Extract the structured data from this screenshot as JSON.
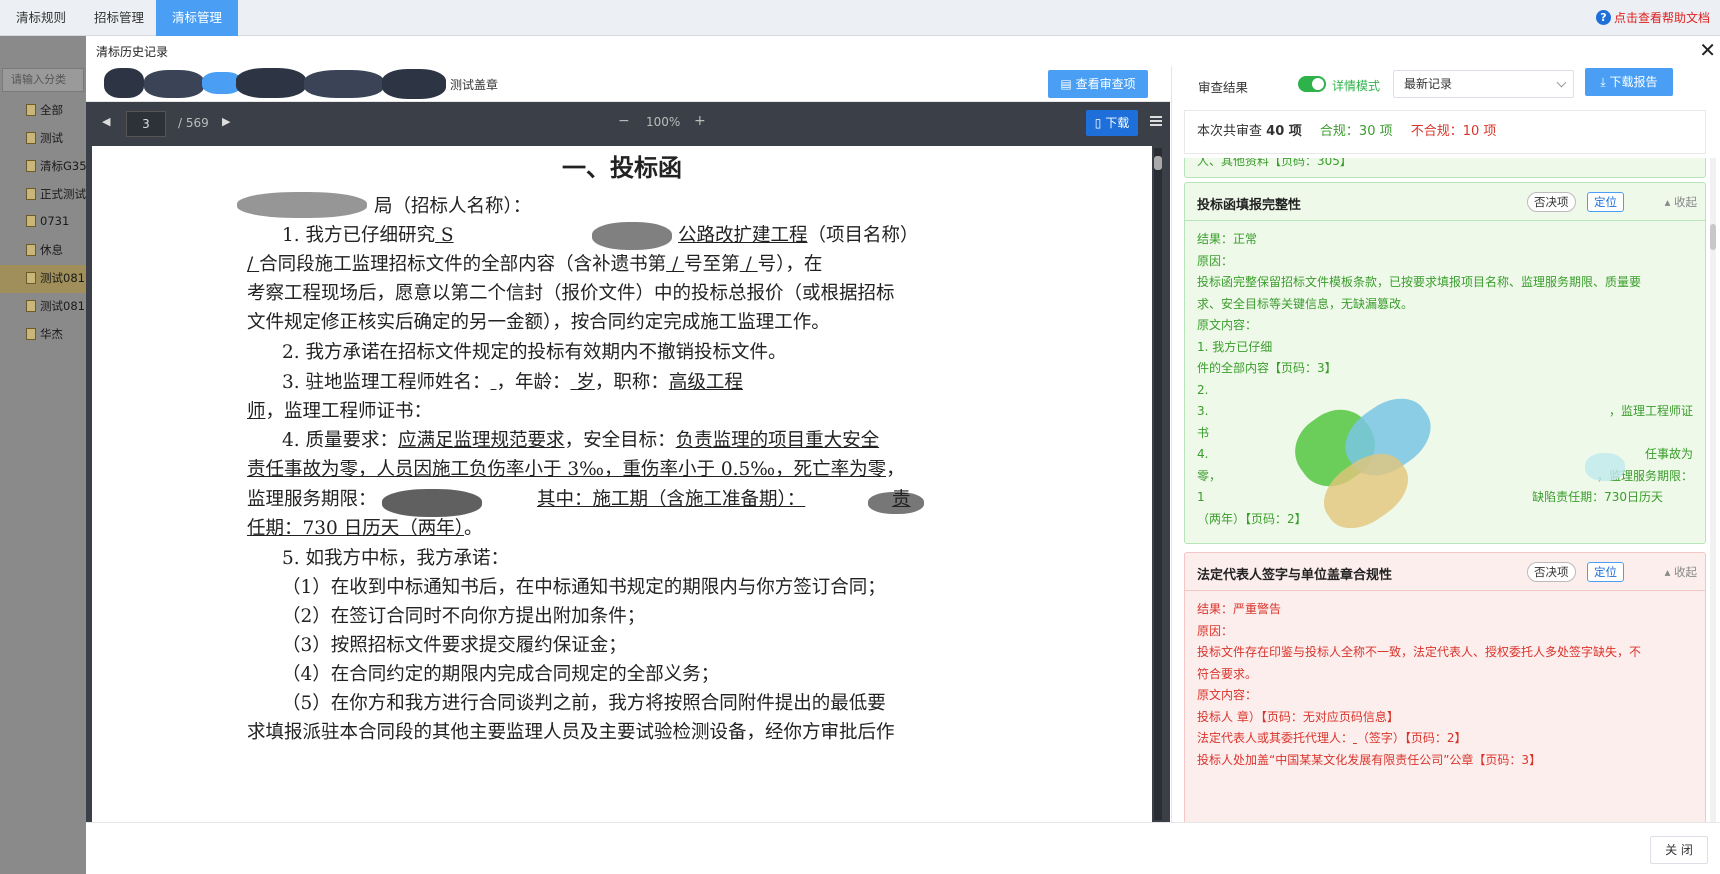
{
  "nav": {
    "tabs": [
      {
        "label": "清标规则"
      },
      {
        "label": "招标管理"
      },
      {
        "label": "清标管理"
      }
    ],
    "help_label": "点击查看帮助文档"
  },
  "sidebar": {
    "search_placeholder": "请输入分类",
    "items": [
      {
        "label": "全部"
      },
      {
        "label": "测试"
      },
      {
        "label": "清标G35"
      },
      {
        "label": "正式测试"
      },
      {
        "label": "0731"
      },
      {
        "label": "休息"
      },
      {
        "label": "测试081"
      },
      {
        "label": "测试081"
      },
      {
        "label": "华杰"
      }
    ]
  },
  "dialog": {
    "title": "清标历史记录",
    "close_label": "✕",
    "footer_close": "关 闭"
  },
  "viewer": {
    "stamp_label": "测试盖章",
    "review_button": "查看审查项",
    "page_current": "3",
    "page_total": "/ 569",
    "zoom_out": "−",
    "zoom": "100%",
    "zoom_in": "+",
    "download": "下载",
    "doc": {
      "heading": "一、投标函",
      "lines": [
        "局（招标人名称）：",
        "1. 我方已仔细研究",
        "公路改扩建工程",
        "（项目名称）",
        "合同段施工监理招标文件的全部内容（含补遗书第",
        "号至第",
        "号），在",
        "考察工程现场后，愿意以第二个信封（报价文件）中的投标总报价（或根据招标",
        "文件规定修正核实后确定的另一金额），按合同约定完成施工监理工作。",
        "2. 我方承诺在招标文件规定的投标有效期内不撤销投标文件。",
        "3. 驻地监理工程师姓名：",
        "，年龄：",
        "岁",
        "，职称：",
        "高级工程",
        "师",
        "，监理工程师证书：",
        "4. 质量要求：",
        "应满足监理规范要求",
        "，安全目标：",
        "负责监理的项目重大安全",
        "责任事故为零，人员因施工负伤率小于 3‰，重伤率小于 0.5‰，死亡率为零",
        "，",
        "监理服务期限：",
        "其中：施工期（含施工准备期）：",
        "责",
        "任期：730 日历天（两年）",
        "。",
        "5. 如我方中标，我方承诺：",
        "（1）在收到中标通知书后，在中标通知书规定的期限内与你方签订合同；",
        "（2）在签订合同时不向你方提出附加条件；",
        "（3）按照招标文件要求提交履约保证金；",
        "（4）在合同约定的期限内完成合同规定的全部义务；",
        "（5）在你方和我方进行合同谈判之前，我方将按照合同附件提出的最低要",
        "求填报派驻本合同段的其他主要监理人员及主要试验检测设备，经你方审批后作"
      ]
    }
  },
  "review": {
    "label": "审查结果",
    "detail_mode": "详情模式",
    "filter_value": "最新记录",
    "download_report": "下载报告",
    "summary_prefix": "本次共审查",
    "summary_total": "40 项",
    "summary_pass": "合规：30 项",
    "summary_fail": "不合规：10 项",
    "prev_tail": "人、其他资料【页码：305】",
    "cards": [
      {
        "title": "投标函填报完整性",
        "tag": "否决项",
        "locate": "定位",
        "collapse": "收起",
        "lines": [
          "结果：正常",
          "原因：",
          "投标函完整保留招标文件模板条款，已按要求填报项目名称、监理服务期限、质量要",
          "求、安全目标等关键信息，无缺漏篡改。",
          "原文内容：",
          "1. 我方已仔细",
          "件的全部内容【页码：3】",
          "2.",
          "3.",
          "，监理工程师证",
          "书",
          "4.",
          "任事故为",
          "零，",
          "，监理服务期限：",
          "1",
          "缺陷责任期：730日历天",
          "（两",
          "年）【页码：2】"
        ]
      },
      {
        "title": "法定代表人签字与单位盖章合规性",
        "tag": "否决项",
        "locate": "定位",
        "collapse": "收起",
        "lines": [
          "结果：严重警告",
          "原因：",
          "投标文件存在印鉴与投标人全称不一致，法定代表人、授权委托人多处签字缺失，不",
          "符合要求。",
          "原文内容：",
          "投标人",
          "章）【页码：无对应页码信息】",
          "法定代表人或其委托代理人：",
          "（签字）【页码：2】",
          "投标人处加盖“中国某某文化发展有限责任公司”公章【页码：3】"
        ]
      }
    ]
  }
}
